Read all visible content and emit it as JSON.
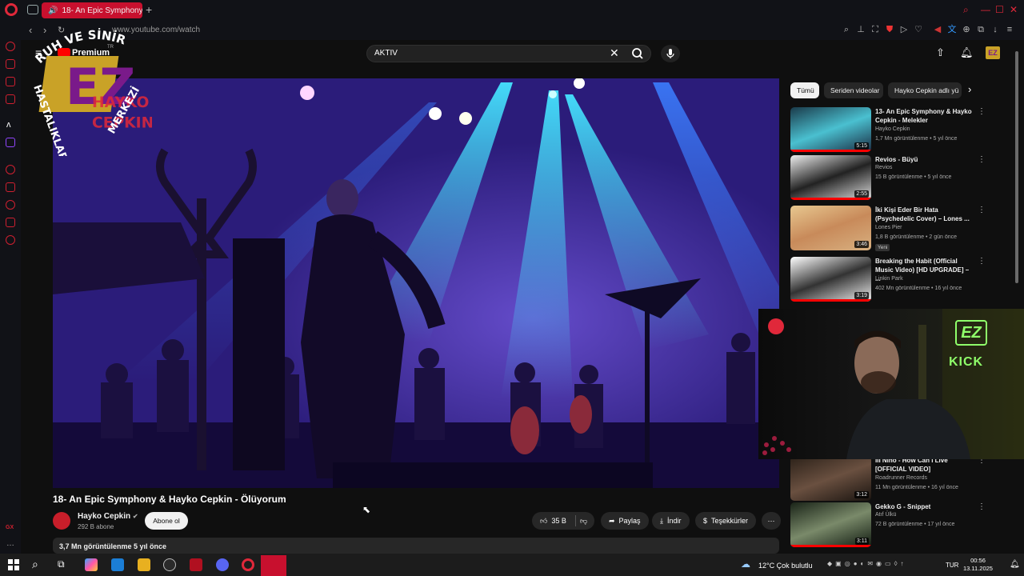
{
  "browser": {
    "tab_title": "18- An Epic Symphony",
    "url": "www.youtube.com/watch",
    "sidebar_label": "GX"
  },
  "youtube": {
    "premium_label": "Premium",
    "premium_sup": "TR",
    "search_value": "AKTIV"
  },
  "overlay": {
    "arc_top": "RUH VE SİNİR",
    "arc_left": "HASTALIKLARI",
    "arc_right": "MERKEZİ",
    "logo_text": "EZ"
  },
  "video": {
    "title": "18- An Epic Symphony & Hayko Cepkin - Ölüyorum",
    "channel": "Hayko Cepkin",
    "subscribers": "292 B abone",
    "subscribe_label": "Abone ol",
    "likes": "35 B",
    "share_label": "Paylaş",
    "download_label": "İndir",
    "thanks_label": "Teşekkürler",
    "views_line": "3,7 Mn görüntülenme  5 yıl önce"
  },
  "chips": [
    "Tümü",
    "Seriden videolar",
    "Hayko Cepkin adlı yü"
  ],
  "recommendations": [
    {
      "title": "13- An Epic Symphony & Hayko Cepkin - Melekler",
      "channel": "Hayko Cepkin",
      "meta": "1,7 Mn görüntülenme • 5 yıl önce",
      "duration": "5:15",
      "progress": 1.0
    },
    {
      "title": "Revios - Büyü",
      "channel": "Revios",
      "meta": "15 B görüntülenme • 5 yıl önce",
      "duration": "2:55",
      "progress": 1.0
    },
    {
      "title": "İki Kişi Eder Bir Hata (Psychedelic Cover) – Lones ...",
      "channel": "Lones Pier",
      "meta": "1,8 B görüntülenme • 2 gün önce",
      "duration": "3:46",
      "badge": "Yeni",
      "progress": 0
    },
    {
      "title": "Breaking the Habit (Official Music Video) [HD UPGRADE] – ...",
      "channel": "Linkin Park",
      "meta": "402 Mn görüntülenme • 16 yıl önce",
      "duration": "3:19",
      "progress": 1.0
    },
    {
      "title": "III Niño - How Can I Live [OFFICIAL VIDEO]",
      "channel": "Roadrunner Records",
      "meta": "11 Mn görüntülenme • 16 yıl önce",
      "duration": "3:12",
      "progress": 0
    },
    {
      "title": "Gekko G - Snippet",
      "channel": "Atıf Ülkü",
      "meta": "72 B görüntülenme • 17 yıl önce",
      "duration": "3:11",
      "progress": 1.0
    }
  ],
  "webcam": {
    "neon_logo": "EZ",
    "neon_text": "KICK"
  },
  "taskbar": {
    "weather": "12°C  Çok bulutlu",
    "lang": "TUR",
    "time": "00:56",
    "date": "13.11.2025"
  },
  "colors": {
    "brand_red": "#c8102e",
    "yt_red": "#ff0000",
    "neon_green": "#8fff6a"
  }
}
